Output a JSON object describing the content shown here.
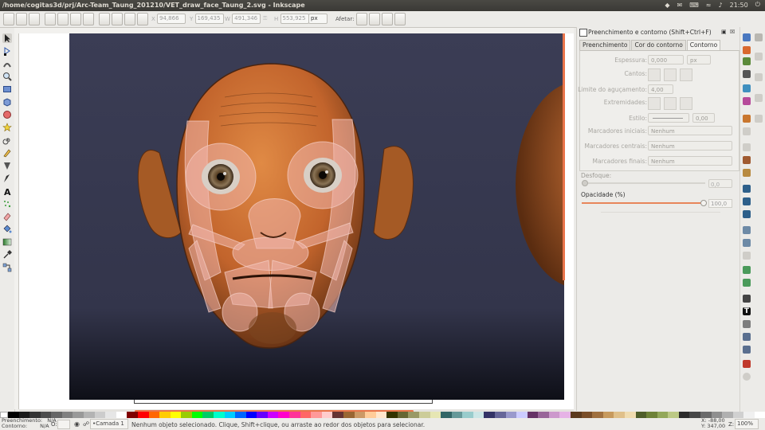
{
  "window": {
    "title": "/home/cogitas3d/prj/Arc-Team_Taung_201210/VET_draw_face_Taung_2.svg - Inkscape",
    "clock": "21:50"
  },
  "controls": {
    "x_label": "X",
    "x_value": "94,866",
    "y_label": "Y",
    "y_value": "169,435",
    "w_label": "W",
    "w_value": "491,346",
    "h_label": "H",
    "h_value": "553,925",
    "unit": "px",
    "affect_label": "Afetar:"
  },
  "panel": {
    "title": "Preenchimento e contorno (Shift+Ctrl+F)",
    "tabs": [
      "Preenchimento",
      "Cor do contorno",
      "Contorno"
    ],
    "active_tab": 2,
    "width_label": "Espessura:",
    "width_value": "0,000",
    "width_unit": "px",
    "join_label": "Cantos:",
    "miter_label": "Limite do aguçamento:",
    "miter_value": "4,00",
    "cap_label": "Extremidades:",
    "dash_label": "Estilo:",
    "dash_value": "0,00",
    "marker_start_label": "Marcadores iniciais:",
    "marker_start_value": "Nenhum",
    "marker_mid_label": "Marcadores centrais:",
    "marker_mid_value": "Nenhum",
    "marker_end_label": "Marcadores finais:",
    "marker_end_value": "Nenhum",
    "blur_label": "Desfoque:",
    "blur_value": "0,0",
    "opacity_label": "Opacidade (%)",
    "opacity_value": "100,0",
    "opacity_level": 1.0,
    "blur_level": 0.0
  },
  "status": {
    "fill_label": "Preenchimento:",
    "fill_value": "N/A",
    "stroke_label": "Contorno:",
    "stroke_value": "N/A",
    "opacity_label": "O:",
    "layer": "•Camada 1",
    "message": "Nenhum objeto selecionado. Clique, Shift+clique, ou arraste ao redor dos objetos para selecionar.",
    "cursor_x_label": "X:",
    "cursor_x": "-88,00",
    "cursor_y_label": "Y:",
    "cursor_y": "347,00",
    "zoom_label": "Z:",
    "zoom": "100%"
  },
  "colors": {
    "canvas_bg": "#3b3d55",
    "skin": "#d4703a",
    "muscle": "#f0b7ad",
    "accent": "#e8855a"
  },
  "palette": [
    "#000000",
    "#1a1a1a",
    "#333333",
    "#4d4d4d",
    "#666666",
    "#808080",
    "#999999",
    "#b3b3b3",
    "#cccccc",
    "#e6e6e6",
    "#ffffff",
    "#800000",
    "#ff0000",
    "#ff6600",
    "#ffcc00",
    "#ffff00",
    "#99cc00",
    "#00ff00",
    "#00cc66",
    "#00ffcc",
    "#00ccff",
    "#0066ff",
    "#0000ff",
    "#6600ff",
    "#cc00ff",
    "#ff00cc",
    "#ff3399",
    "#ff6666",
    "#ff9999",
    "#ffcccc",
    "#663333",
    "#996633",
    "#cc9966",
    "#ffcc99",
    "#ffe6cc",
    "#333300",
    "#666633",
    "#999966",
    "#cccc99",
    "#e6e6b3",
    "#336666",
    "#669999",
    "#99cccc",
    "#cce6e6",
    "#333366",
    "#666699",
    "#9999cc",
    "#ccccff",
    "#663366",
    "#996699",
    "#cc99cc",
    "#e6b3e6",
    "#5c3a1e",
    "#7a4e29",
    "#a0703f",
    "#c79a5e",
    "#e0c08a",
    "#f0dcb0",
    "#4f5e2a",
    "#6e8238",
    "#93a85a",
    "#bcc985",
    "#2b2b2b",
    "#474747",
    "#6b6b6b",
    "#8f8f8f",
    "#b0b0b0",
    "#d0d0d0",
    "#f0f0f0",
    "#ffffff"
  ]
}
